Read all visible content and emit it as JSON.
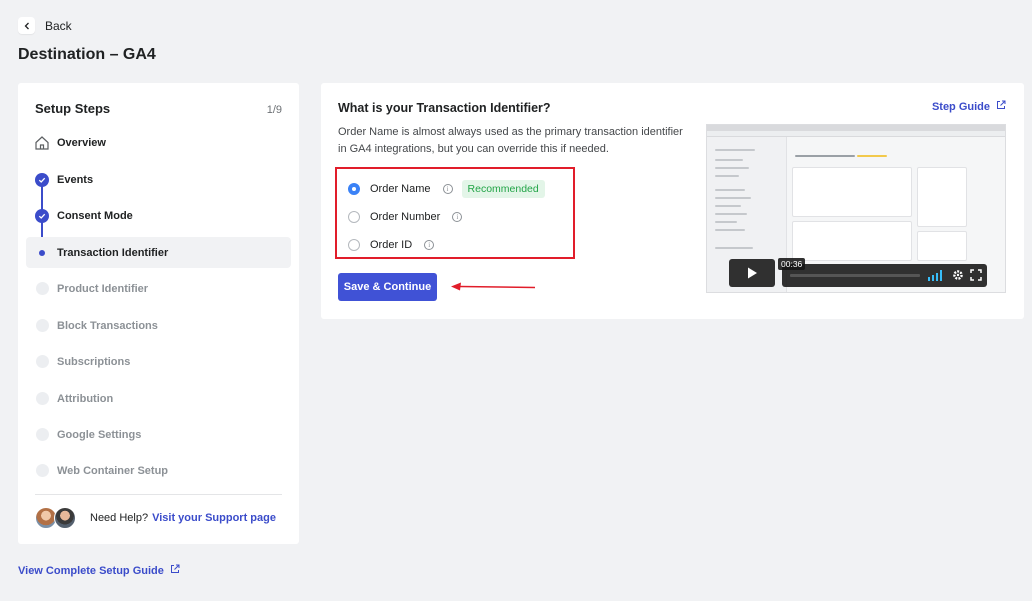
{
  "header": {
    "back_label": "Back",
    "page_title": "Destination – GA4"
  },
  "steps": {
    "title": "Setup Steps",
    "counter": "1/9",
    "items": [
      {
        "label": "Overview",
        "state": "overview",
        "icon": "home-icon"
      },
      {
        "label": "Events",
        "state": "done"
      },
      {
        "label": "Consent Mode",
        "state": "done"
      },
      {
        "label": "Transaction Identifier",
        "state": "active"
      },
      {
        "label": "Product Identifier",
        "state": "pending"
      },
      {
        "label": "Block Transactions",
        "state": "pending"
      },
      {
        "label": "Subscriptions",
        "state": "pending"
      },
      {
        "label": "Attribution",
        "state": "pending"
      },
      {
        "label": "Google Settings",
        "state": "pending"
      },
      {
        "label": "Web Container Setup",
        "state": "pending"
      }
    ],
    "help_text": "Need Help?",
    "help_link": "Visit your Support page"
  },
  "footer": {
    "guide_link": "View Complete Setup Guide"
  },
  "main": {
    "question": "What is your Transaction Identifier?",
    "description": "Order Name is almost always used as the primary transaction identifier in GA4 integrations, but you can override this if needed.",
    "step_guide": "Step Guide",
    "options": [
      {
        "label": "Order Name",
        "checked": true,
        "badge": "Recommended"
      },
      {
        "label": "Order Number",
        "checked": false
      },
      {
        "label": "Order ID",
        "checked": false
      }
    ],
    "save_label": "Save & Continue",
    "video": {
      "time": "00:36"
    }
  },
  "colors": {
    "accent": "#3b4cca",
    "button": "#4052d6",
    "highlight": "#e11d2a",
    "badge_green": "#22a447"
  }
}
